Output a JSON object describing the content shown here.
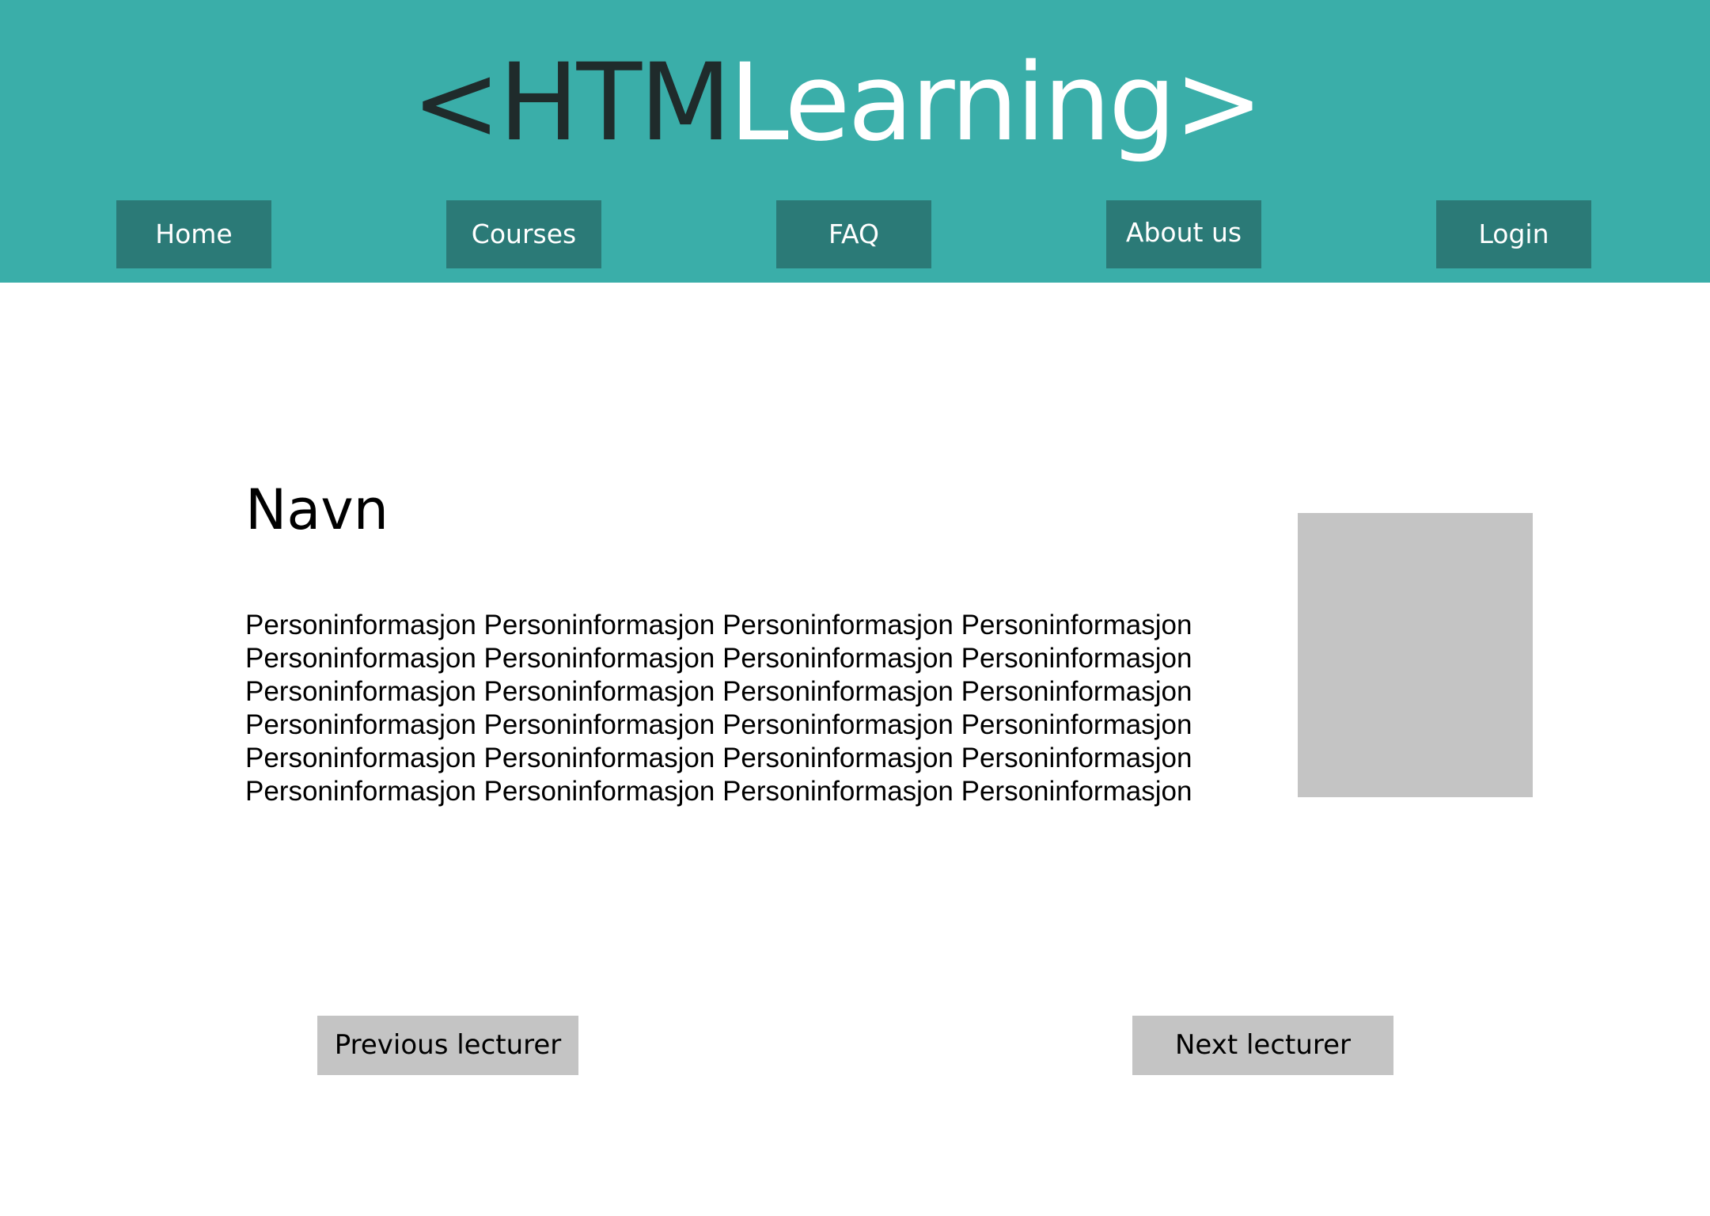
{
  "header": {
    "logo": {
      "prefix": "<HTM",
      "suffix": "Learning>"
    },
    "nav": [
      {
        "label": "Home"
      },
      {
        "label": "Courses"
      },
      {
        "label": "FAQ"
      },
      {
        "label": "About us"
      },
      {
        "label": "Login"
      }
    ],
    "colors": {
      "header_bg": "#3aaea9",
      "nav_bg": "#2b7a77"
    }
  },
  "main": {
    "title": "Navn",
    "bio_lines": [
      "Personinformasjon Personinformasjon Personinformasjon Personinformasjon",
      "Personinformasjon Personinformasjon Personinformasjon Personinformasjon",
      "Personinformasjon Personinformasjon Personinformasjon Personinformasjon",
      "Personinformasjon Personinformasjon Personinformasjon Personinformasjon",
      "Personinformasjon Personinformasjon Personinformasjon Personinformasjon",
      "Personinformasjon Personinformasjon Personinformasjon Personinformasjon"
    ]
  },
  "pager": {
    "previous_label": "Previous lecturer",
    "next_label": "Next lecturer"
  }
}
